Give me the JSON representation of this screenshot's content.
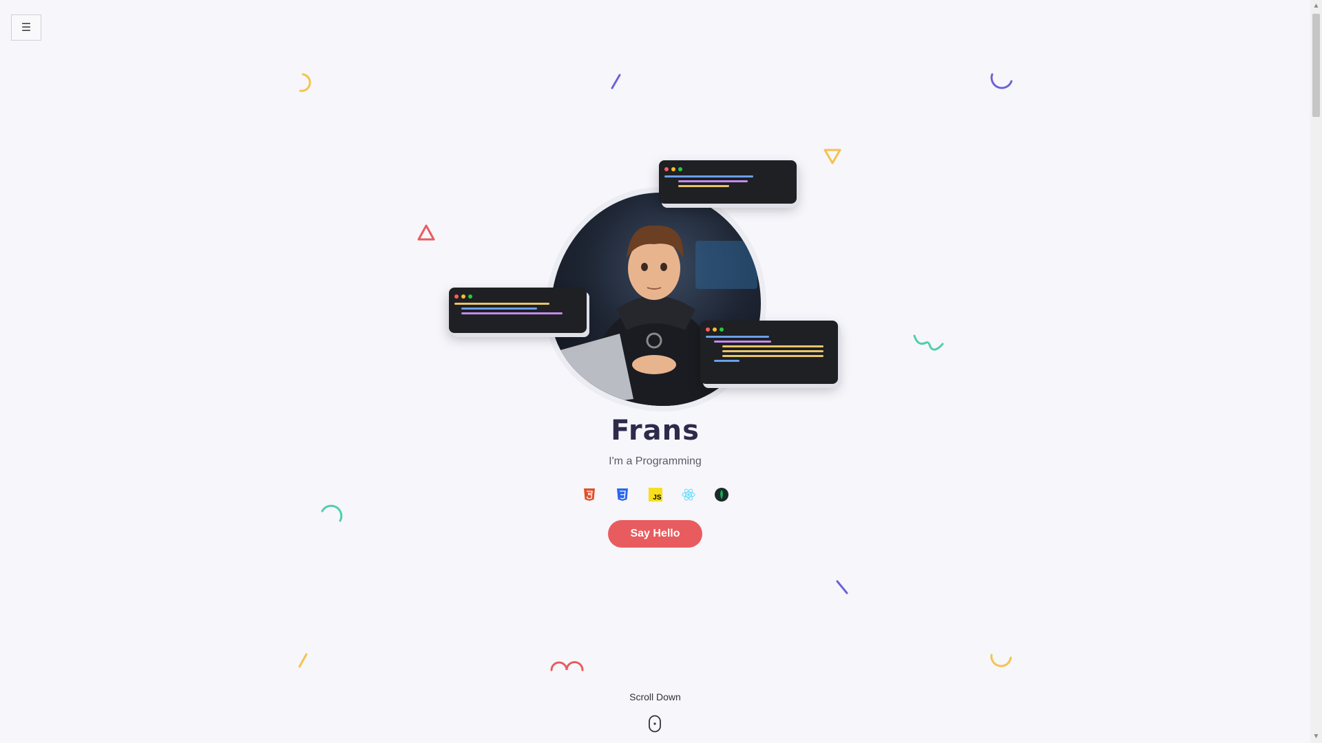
{
  "nav": {
    "menu_icon": "hamburger-icon",
    "menu_glyph": "☰"
  },
  "hero": {
    "name": "Frans",
    "tagline": "I'm a Programming",
    "tech_icons": [
      "html5-icon",
      "css3-icon",
      "javascript-icon",
      "react-icon",
      "mongodb-icon"
    ],
    "js_label": "JS",
    "cta_label": "Say Hello",
    "scroll_label": "Scroll Down"
  },
  "colors": {
    "accent": "#e85c5f",
    "yellow": "#f5c24b",
    "purple": "#6b63d6",
    "teal": "#4fcfad",
    "red": "#e85c5f",
    "background": "#f6f6fb"
  }
}
